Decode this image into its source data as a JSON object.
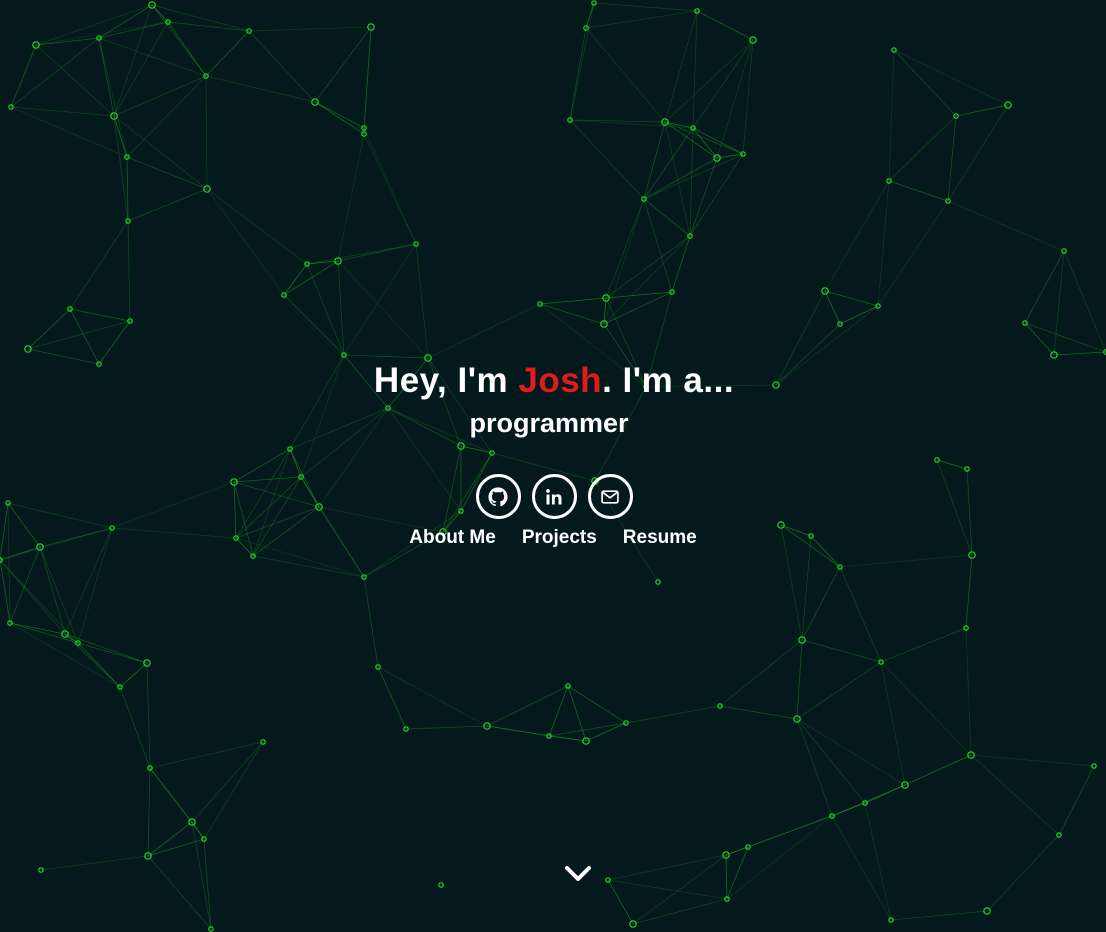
{
  "hero": {
    "greeting_prefix": "Hey, I'm ",
    "name": "Josh",
    "greeting_suffix": ". I'm a...",
    "role": "programmer"
  },
  "socials": [
    {
      "icon": "github-icon",
      "label": "GitHub"
    },
    {
      "icon": "linkedin-icon",
      "label": "LinkedIn"
    },
    {
      "icon": "mail-icon",
      "label": "Email"
    }
  ],
  "nav": {
    "about": "About Me",
    "projects": "Projects",
    "resume": "Resume"
  },
  "scroll": {
    "icon": "chevron-down-icon"
  },
  "colors": {
    "background": "#04191c",
    "accent": "#e01b1b",
    "network_line": "#1f9e1f",
    "network_node": "#2bd42b",
    "text": "#ffffff"
  }
}
